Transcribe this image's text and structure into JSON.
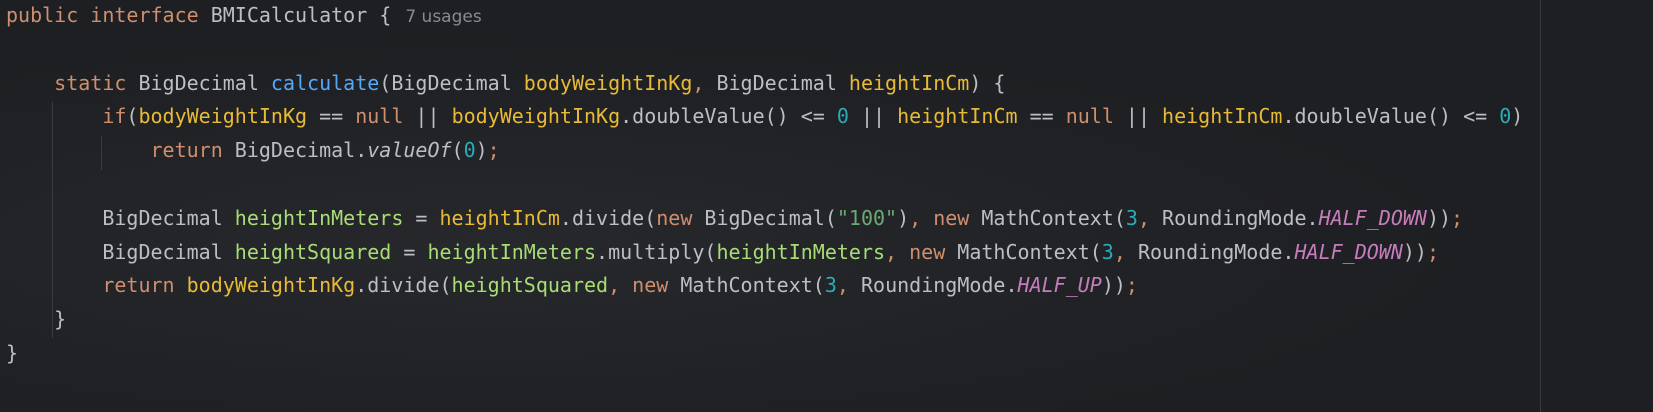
{
  "editor": {
    "colors": {
      "background": "#1e1f22",
      "keyword": "#cf8e6d",
      "method": "#56a8f5",
      "parameter": "#e8ba36",
      "local": "#a9dc76",
      "number": "#2aacb8",
      "string": "#6aab73",
      "constant": "#c77dbb",
      "hint": "#868a91"
    },
    "lines": [
      [
        [
          "kw",
          "public interface "
        ],
        [
          "cls",
          "BMICalculator {"
        ],
        [
          "hint",
          "7 usages"
        ]
      ],
      [],
      [
        [
          "kw",
          "    static "
        ],
        [
          "cls",
          "BigDecimal "
        ],
        [
          "fn",
          "calculate"
        ],
        [
          "punc",
          "(BigDecimal "
        ],
        [
          "param",
          "bodyWeightInKg"
        ],
        [
          "kw",
          ", "
        ],
        [
          "punc",
          "BigDecimal "
        ],
        [
          "param",
          "heightInCm"
        ],
        [
          "punc",
          ") {"
        ]
      ],
      [
        [
          "kw",
          "        if"
        ],
        [
          "punc",
          "("
        ],
        [
          "param",
          "bodyWeightInKg"
        ],
        [
          "punc",
          " == "
        ],
        [
          "kw",
          "null"
        ],
        [
          "punc",
          " || "
        ],
        [
          "param",
          "bodyWeightInKg"
        ],
        [
          "punc",
          ".doubleValue() <= "
        ],
        [
          "num",
          "0"
        ],
        [
          "punc",
          " || "
        ],
        [
          "param",
          "heightInCm"
        ],
        [
          "punc",
          " == "
        ],
        [
          "kw",
          "null"
        ],
        [
          "punc",
          " || "
        ],
        [
          "param",
          "heightInCm"
        ],
        [
          "punc",
          ".doubleValue() <= "
        ],
        [
          "num",
          "0"
        ],
        [
          "punc",
          ")"
        ]
      ],
      [
        [
          "kw",
          "            return "
        ],
        [
          "punc",
          "BigDecimal."
        ],
        [
          "ital",
          "valueOf"
        ],
        [
          "punc",
          "("
        ],
        [
          "num",
          "0"
        ],
        [
          "punc",
          ")"
        ],
        [
          "semi",
          ";"
        ]
      ],
      [],
      [
        [
          "punc",
          "        BigDecimal "
        ],
        [
          "local",
          "heightInMeters"
        ],
        [
          "punc",
          " = "
        ],
        [
          "param",
          "heightInCm"
        ],
        [
          "punc",
          ".divide("
        ],
        [
          "kw",
          "new "
        ],
        [
          "punc",
          "BigDecimal("
        ],
        [
          "str",
          "\"100\""
        ],
        [
          "punc",
          ")"
        ],
        [
          "kw",
          ", "
        ],
        [
          "kw",
          "new "
        ],
        [
          "punc",
          "MathContext("
        ],
        [
          "num",
          "3"
        ],
        [
          "kw",
          ", "
        ],
        [
          "punc",
          "RoundingMode."
        ],
        [
          "const",
          "HALF_DOWN"
        ],
        [
          "punc",
          "))"
        ],
        [
          "semi",
          ";"
        ]
      ],
      [
        [
          "punc",
          "        BigDecimal "
        ],
        [
          "local",
          "heightSquared"
        ],
        [
          "punc",
          " = "
        ],
        [
          "local",
          "heightInMeters"
        ],
        [
          "punc",
          ".multiply("
        ],
        [
          "local",
          "heightInMeters"
        ],
        [
          "kw",
          ", "
        ],
        [
          "kw",
          "new "
        ],
        [
          "punc",
          "MathContext("
        ],
        [
          "num",
          "3"
        ],
        [
          "kw",
          ", "
        ],
        [
          "punc",
          "RoundingMode."
        ],
        [
          "const",
          "HALF_DOWN"
        ],
        [
          "punc",
          "))"
        ],
        [
          "semi",
          ";"
        ]
      ],
      [
        [
          "kw",
          "        return "
        ],
        [
          "param",
          "bodyWeightInKg"
        ],
        [
          "punc",
          ".divide("
        ],
        [
          "local",
          "heightSquared"
        ],
        [
          "kw",
          ", "
        ],
        [
          "kw",
          "new "
        ],
        [
          "punc",
          "MathContext("
        ],
        [
          "num",
          "3"
        ],
        [
          "kw",
          ", "
        ],
        [
          "punc",
          "RoundingMode."
        ],
        [
          "const",
          "HALF_UP"
        ],
        [
          "punc",
          "))"
        ],
        [
          "semi",
          ";"
        ]
      ],
      [
        [
          "punc",
          "    }"
        ]
      ],
      [
        [
          "punc",
          "}"
        ]
      ]
    ]
  }
}
